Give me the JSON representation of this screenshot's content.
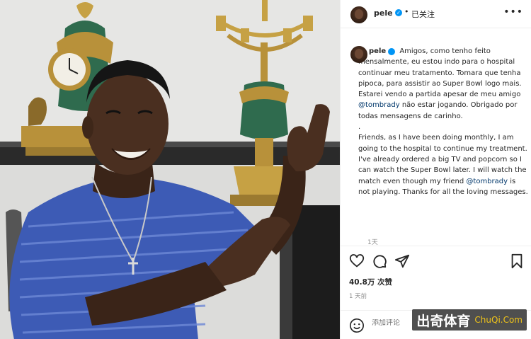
{
  "header": {
    "username": "pele",
    "verified_mark": "✓",
    "separator": "•",
    "follow_status": "已关注",
    "more_icon": "•••"
  },
  "caption": {
    "username": "pele",
    "paragraph_pt_1": "Amigos, como tenho feito mensalmente, eu estou indo para o hospital continuar meu tratamento. Tomara que tenha pipoca, para assistir ao Super Bowl logo mais. Estarei vendo a partida apesar de meu amigo",
    "mention_pt": "@tombrady",
    "paragraph_pt_2": "não estar jogando. Obrigado por todas mensagens de carinho.",
    "dot_line": ".",
    "paragraph_en_1": "Friends, as I have been doing monthly, I am going to the hospital to continue my treatment. I've already ordered a big TV and popcorn so I can watch the Super Bowl later. I will watch the match even though my friend",
    "mention_en": "@tombrady",
    "paragraph_en_2": "is not playing. Thanks for all the loving messages.",
    "time": "1天"
  },
  "actions": {
    "like_icon": "heart-icon",
    "comment_icon": "comment-icon",
    "share_icon": "share-icon",
    "save_icon": "bookmark-icon"
  },
  "likes_text": "40.8万 次赞",
  "post_time": "1 天前",
  "comment": {
    "placeholder": "添加评论"
  },
  "watermark": {
    "cn": "出奇体育",
    "en": "ChuQi.Com"
  },
  "colors": {
    "verified": "#0095f6",
    "mention": "#00376b",
    "muted": "#8e8e8e",
    "divider": "#efefef",
    "shirt": "#3d5bb5",
    "watermark_en": "#f0c419"
  }
}
